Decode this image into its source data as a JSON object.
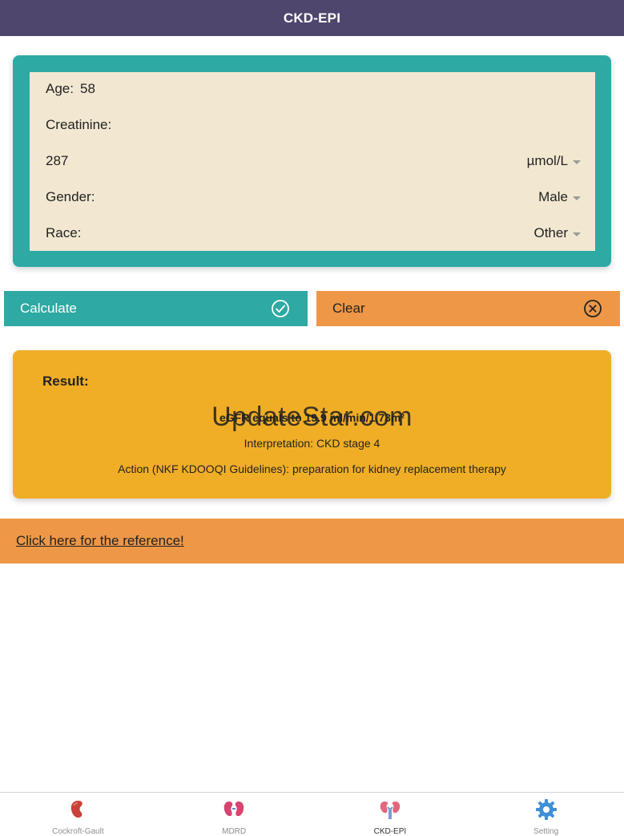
{
  "nav": {
    "title": "CKD-EPI"
  },
  "form": {
    "age_label": "Age:",
    "age_value": "58",
    "creatinine_label": "Creatinine:",
    "creatinine_value": "287",
    "creatinine_unit": "µmol/L",
    "gender_label": "Gender:",
    "gender_value": "Male",
    "race_label": "Race:",
    "race_value": "Other"
  },
  "buttons": {
    "calculate_label": "Calculate",
    "clear_label": "Clear"
  },
  "result": {
    "title": "Result:",
    "egfr": "eGFR equals to 19.9 ml/min/1.73m²",
    "interpretation": "Interpretation: CKD stage 4",
    "action": "Action (NKF KDOOQI Guidelines): preparation for kidney replacement therapy",
    "watermark": "UpdateStar.com"
  },
  "reference": {
    "link_text": "Click here for the reference!"
  },
  "tabs": [
    {
      "label": "Cockroft-Gault",
      "icon": "kidney-icon"
    },
    {
      "label": "MDRD",
      "icon": "kidneys-icon"
    },
    {
      "label": "CKD-EPI",
      "icon": "kidneys-ureter-icon"
    },
    {
      "label": "Setting",
      "icon": "gear-icon"
    }
  ],
  "colors": {
    "nav": "#4e466d",
    "teal": "#2ea9a3",
    "cream": "#f2e8d1",
    "orange": "#ee9747",
    "result": "#f0ae27"
  }
}
